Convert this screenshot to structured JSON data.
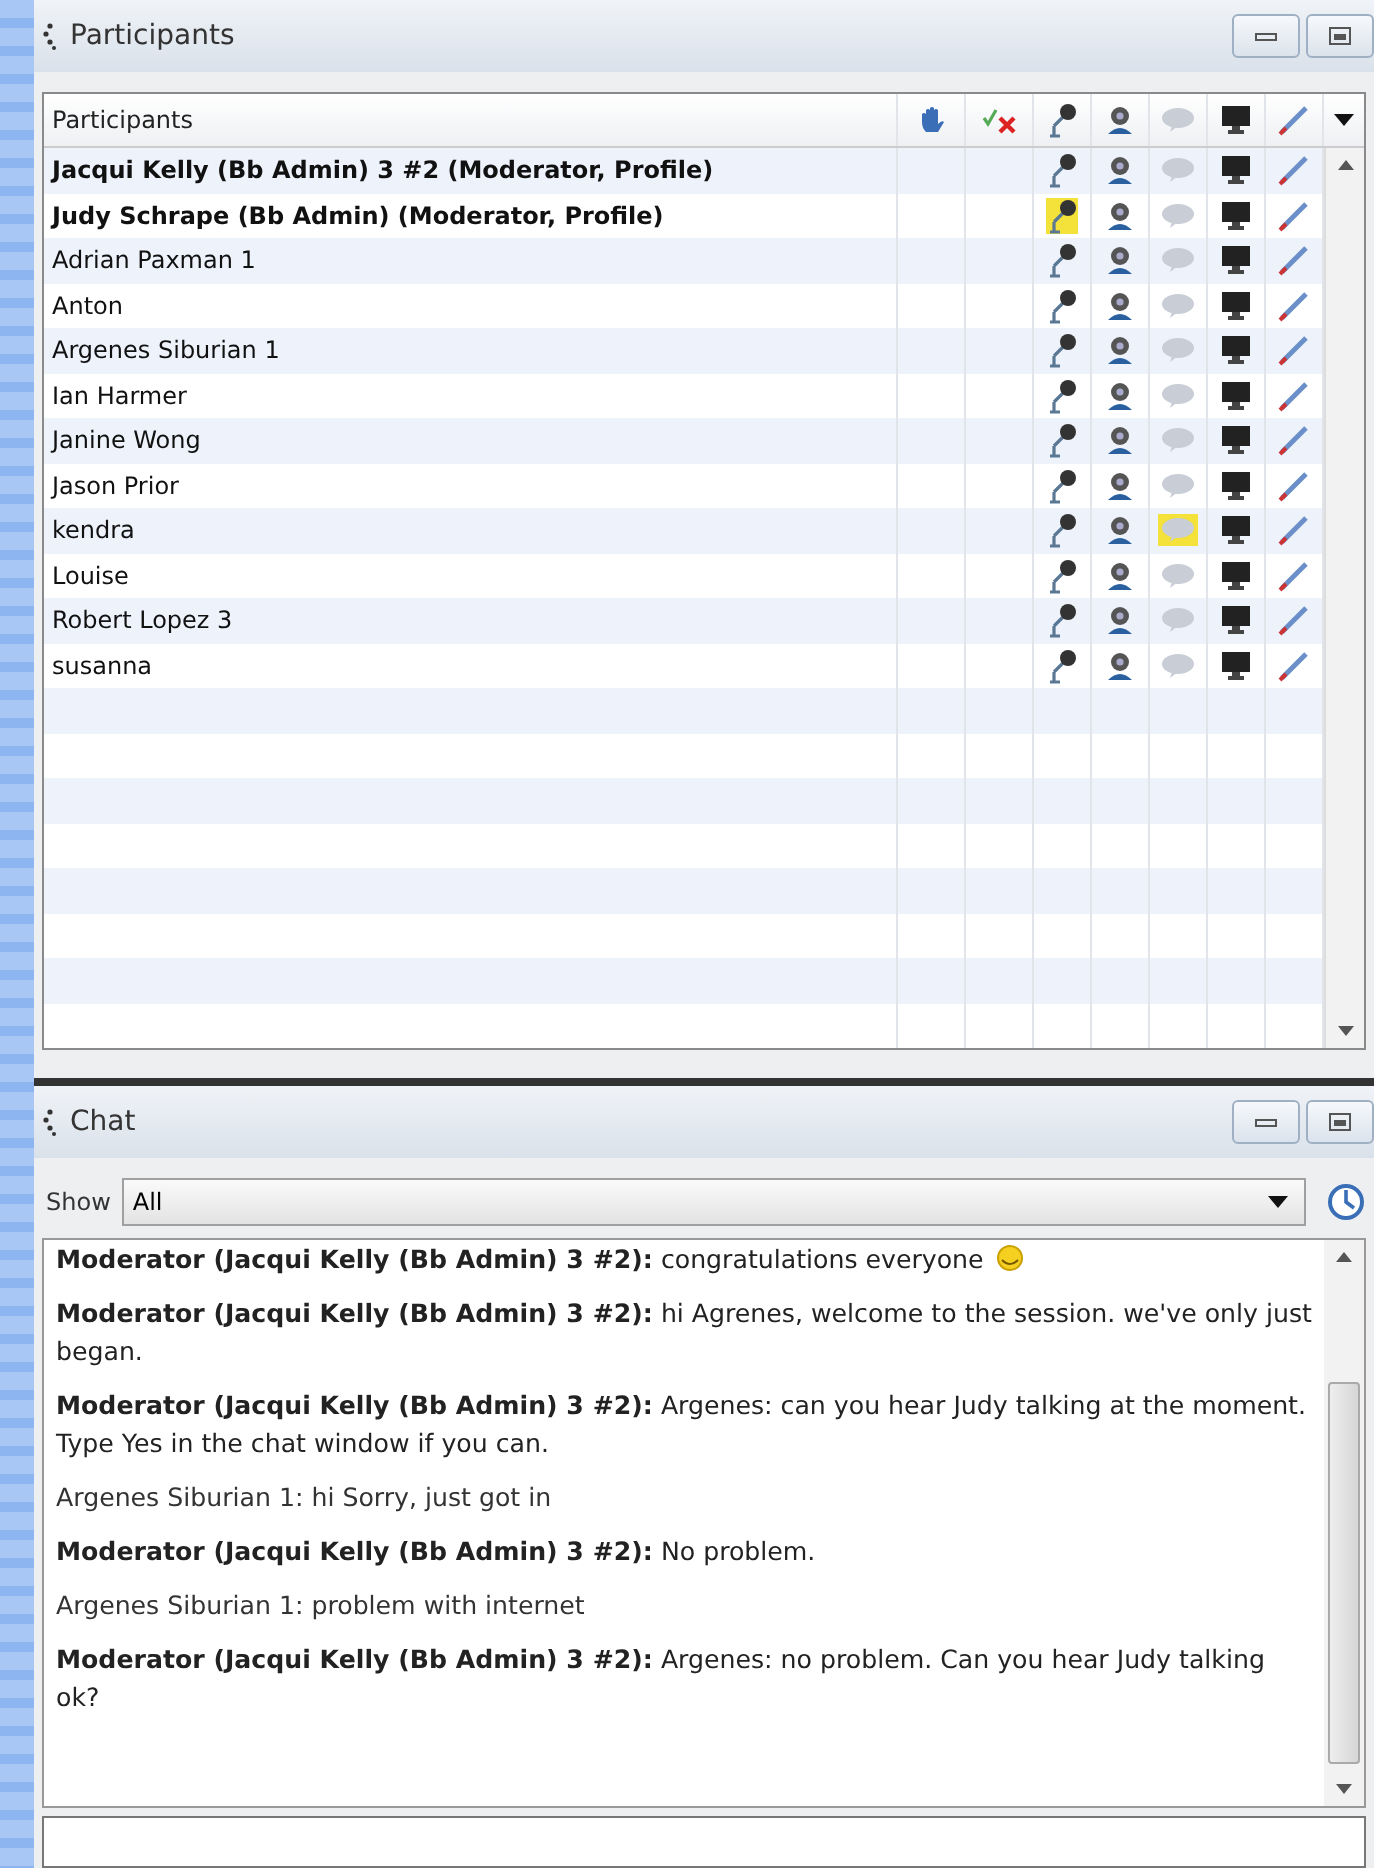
{
  "participants_panel": {
    "title": "Participants",
    "column_header": "Participants",
    "rows": [
      {
        "name": "Jacqui Kelly (Bb Admin) 3 #2 (Moderator, Profile)",
        "moderator": true,
        "talking": false,
        "chatting": false
      },
      {
        "name": "Judy Schrape (Bb Admin) (Moderator, Profile)",
        "moderator": true,
        "talking": true,
        "chatting": false
      },
      {
        "name": "Adrian Paxman 1",
        "moderator": false,
        "talking": false,
        "chatting": false
      },
      {
        "name": "Anton",
        "moderator": false,
        "talking": false,
        "chatting": false
      },
      {
        "name": "Argenes Siburian 1",
        "moderator": false,
        "talking": false,
        "chatting": false
      },
      {
        "name": "Ian Harmer",
        "moderator": false,
        "talking": false,
        "chatting": false
      },
      {
        "name": "Janine Wong",
        "moderator": false,
        "talking": false,
        "chatting": false
      },
      {
        "name": "Jason Prior",
        "moderator": false,
        "talking": false,
        "chatting": false
      },
      {
        "name": "kendra",
        "moderator": false,
        "talking": false,
        "chatting": true
      },
      {
        "name": "Louise",
        "moderator": false,
        "talking": false,
        "chatting": false
      },
      {
        "name": "Robert Lopez 3",
        "moderator": false,
        "talking": false,
        "chatting": false
      },
      {
        "name": "susanna",
        "moderator": false,
        "talking": false,
        "chatting": false
      }
    ]
  },
  "chat_panel": {
    "title": "Chat",
    "show_label": "Show",
    "show_value": "All",
    "messages": [
      {
        "kind": "moderator",
        "text": "**Moderator (Jacqui Kelly (Bb Admin) 3 #2):** congratulations everyone",
        "smiley": true
      },
      {
        "kind": "moderator",
        "text": "**Moderator (Jacqui Kelly (Bb Admin) 3 #2):** hi Agrenes, welcome to the session. we've only just began.",
        "smiley": false
      },
      {
        "kind": "moderator",
        "text": "**Moderator (Jacqui Kelly (Bb Admin) 3 #2):** Argenes: can you hear Judy talking at the moment. Type Yes in the chat window if you can.",
        "smiley": false
      },
      {
        "kind": "participant",
        "text": "Argenes Siburian 1: hi Sorry, just got in",
        "smiley": false
      },
      {
        "kind": "moderator",
        "text": "**Moderator (Jacqui Kelly (Bb Admin) 3 #2):** No problem.",
        "smiley": false
      },
      {
        "kind": "participant",
        "text": "Argenes Siburian 1: problem with internet",
        "smiley": false
      },
      {
        "kind": "moderator",
        "text": "**Moderator (Jacqui Kelly (Bb Admin) 3 #2):** Argenes: no problem. Can you hear Judy talking ok?",
        "smiley": false
      }
    ]
  }
}
